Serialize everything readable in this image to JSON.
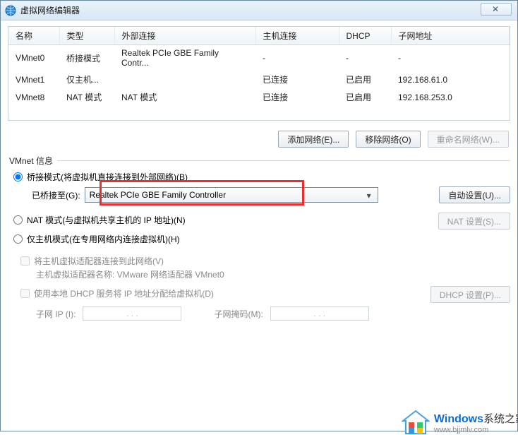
{
  "titlebar": {
    "title": "虚拟网络编辑器",
    "close_glyph": "✕"
  },
  "table": {
    "headers": {
      "name": "名称",
      "type": "类型",
      "ext": "外部连接",
      "host": "主机连接",
      "dhcp": "DHCP",
      "subnet": "子网地址"
    },
    "rows": [
      {
        "name": "VMnet0",
        "type": "桥接模式",
        "ext": "Realtek PCIe GBE Family Contr...",
        "host": "-",
        "dhcp": "-",
        "subnet": "-"
      },
      {
        "name": "VMnet1",
        "type": "仅主机...",
        "ext": "",
        "host": "已连接",
        "dhcp": "已启用",
        "subnet": "192.168.61.0"
      },
      {
        "name": "VMnet8",
        "type": "NAT 模式",
        "ext": "NAT 模式",
        "host": "已连接",
        "dhcp": "已启用",
        "subnet": "192.168.253.0"
      }
    ]
  },
  "buttons": {
    "add": "添加网络(E)...",
    "remove": "移除网络(O)",
    "rename": "重命名网络(W)...",
    "auto": "自动设置(U)...",
    "nat": "NAT 设置(S)...",
    "dhcp": "DHCP 设置(P)..."
  },
  "group": {
    "label": "VMnet 信息"
  },
  "radios": {
    "bridge": "桥接模式(将虚拟机直接连接到外部网络)(B)",
    "bridge_to_label": "已桥接至(G):",
    "bridge_to_value": "Realtek PCIe GBE Family Controller",
    "nat": "NAT 模式(与虚拟机共享主机的 IP 地址)(N)",
    "hostonly": "仅主机模式(在专用网络内连接虚拟机)(H)"
  },
  "checks": {
    "connect_host": "将主机虚拟适配器连接到此网络(V)",
    "connect_host_hint": "主机虚拟适配器名称: VMware 网络适配器 VMnet0",
    "dhcp": "使用本地 DHCP 服务将 IP 地址分配给虚拟机(D)"
  },
  "ip": {
    "subnet_label": "子网 IP (I):",
    "mask_label": "子网掩码(M):",
    "dots": ".   .   ."
  },
  "watermark": {
    "brand": "Windows",
    "sub1": "系统之家",
    "sub2": "www.bjjmlv.com"
  }
}
